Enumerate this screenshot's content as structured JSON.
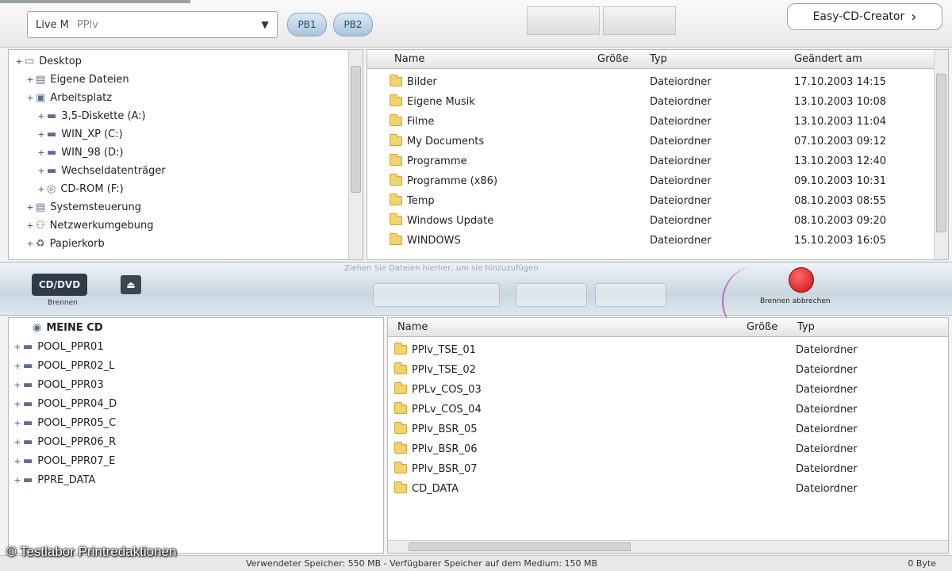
{
  "toolbar": {
    "path_combo": {
      "label": "Live M",
      "value": "PPlv"
    },
    "pill_buttons": [
      "PB1",
      "PB2"
    ],
    "tab_buttons": [
      "",
      ""
    ],
    "top_right": {
      "label": "Easy-CD-Creator",
      "chevron": "›"
    }
  },
  "tree_top": {
    "items": [
      {
        "label": "Desktop",
        "indent": 0,
        "icon": "desktop-icon"
      },
      {
        "label": "Eigene Dateien",
        "indent": 1,
        "icon": "folder-icon"
      },
      {
        "label": "Arbeitsplatz",
        "indent": 1,
        "icon": "computer-icon"
      },
      {
        "label": "3,5-Diskette (A:)",
        "indent": 2,
        "icon": "drive-icon"
      },
      {
        "label": "WIN_XP (C:)",
        "indent": 2,
        "icon": "drive-icon"
      },
      {
        "label": "WIN_98 (D:)",
        "indent": 2,
        "icon": "drive-icon"
      },
      {
        "label": "Wechseldatenträger",
        "indent": 2,
        "icon": "drive-icon"
      },
      {
        "label": "CD-ROM (F:)",
        "indent": 2,
        "icon": "cdrom-icon"
      },
      {
        "label": "Systemsteuerung",
        "indent": 1,
        "icon": "folder-icon"
      },
      {
        "label": "Netzwerkumgebung",
        "indent": 1,
        "icon": "network-icon"
      },
      {
        "label": "Papierkorb",
        "indent": 1,
        "icon": "trash-icon"
      }
    ]
  },
  "list_top": {
    "columns": [
      "Name",
      "Größe",
      "Typ",
      "Geändert am"
    ],
    "rows": [
      {
        "name": "Bilder",
        "size": "",
        "type": "Dateiordner",
        "modified": "17.10.2003 14:15"
      },
      {
        "name": "Eigene Musik",
        "size": "",
        "type": "Dateiordner",
        "modified": "13.10.2003 10:08"
      },
      {
        "name": "Filme",
        "size": "",
        "type": "Dateiordner",
        "modified": "13.10.2003 11:04"
      },
      {
        "name": "My Documents",
        "size": "",
        "type": "Dateiordner",
        "modified": "07.10.2003 09:12"
      },
      {
        "name": "Programme",
        "size": "",
        "type": "Dateiordner",
        "modified": "13.10.2003 12:40"
      },
      {
        "name": "Programme (x86)",
        "size": "",
        "type": "Dateiordner",
        "modified": "09.10.2003 10:31"
      },
      {
        "name": "Temp",
        "size": "",
        "type": "Dateiordner",
        "modified": "08.10.2003 08:55"
      },
      {
        "name": "Windows Update",
        "size": "",
        "type": "Dateiordner",
        "modified": "08.10.2003 09:20"
      },
      {
        "name": "WINDOWS",
        "size": "",
        "type": "Dateiordner",
        "modified": "15.10.2003 16:05"
      }
    ]
  },
  "band": {
    "burn_button": "CD/DVD",
    "burn_label": "Brennen",
    "eject_button": "⏏",
    "caption": "Ziehen Sie Dateien hierher, um sie hinzuzufügen",
    "stop_label": "Brennen abbrechen"
  },
  "tree_bottom": {
    "root": "MEINE CD",
    "items": [
      "POOL_PPR01",
      "POOL_PPR02_L",
      "POOL_PPR03",
      "POOL_PPR04_D",
      "POOL_PPR05_C",
      "POOL_PPR06_R",
      "POOL_PPR07_E",
      "PPRE_DATA"
    ]
  },
  "list_bottom": {
    "columns": [
      "Name",
      "Größe",
      "Typ"
    ],
    "rows": [
      {
        "name": "PPlv_TSE_01",
        "type": "Dateiordner"
      },
      {
        "name": "PPlv_TSE_02",
        "type": "Dateiordner"
      },
      {
        "name": "PPLv_COS_03",
        "type": "Dateiordner"
      },
      {
        "name": "PPLv_COS_04",
        "type": "Dateiordner"
      },
      {
        "name": "PPlv_BSR_05",
        "type": "Dateiordner"
      },
      {
        "name": "PPlv_BSR_06",
        "type": "Dateiordner"
      },
      {
        "name": "PPlv_BSR_07",
        "type": "Dateiordner"
      },
      {
        "name": "CD_DATA",
        "type": "Dateiordner"
      }
    ]
  },
  "status": {
    "left": "Verwendeter Speicher: 550 MB - Verfügbarer Speicher auf dem Medium: 150 MB",
    "right": "0 Byte"
  },
  "watermark": "© Testlabor Printredaktionen"
}
